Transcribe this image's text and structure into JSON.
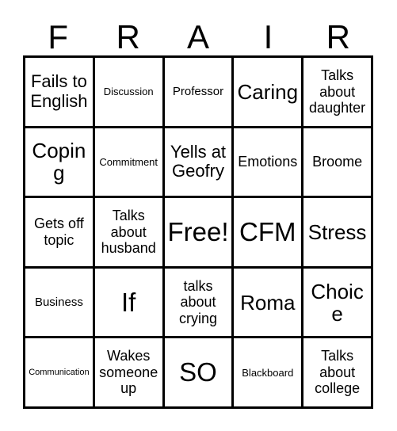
{
  "card": {
    "title_letters": [
      "F",
      "R",
      "A",
      "I",
      "R"
    ],
    "border_color": "#000000",
    "background_color": "#ffffff",
    "text_color": "#000000",
    "columns": 5,
    "rows": 5,
    "free_space": "Free!",
    "free_space_position": {
      "row": 3,
      "column": 3
    },
    "cells": [
      [
        {
          "label": "Fails to English",
          "size": "lg"
        },
        {
          "label": "Discussion",
          "size": "xs"
        },
        {
          "label": "Professor",
          "size": "sm"
        },
        {
          "label": "Caring",
          "size": "xl"
        },
        {
          "label": "Talks about daughter",
          "size": "md"
        }
      ],
      [
        {
          "label": "Coping",
          "size": "xl"
        },
        {
          "label": "Commitment",
          "size": "xs"
        },
        {
          "label": "Yells at Geofry",
          "size": "lg"
        },
        {
          "label": "Emotions",
          "size": "md"
        },
        {
          "label": "Broome",
          "size": "md"
        }
      ],
      [
        {
          "label": "Gets off topic",
          "size": "md"
        },
        {
          "label": "Talks about husband",
          "size": "md"
        },
        {
          "label": "Free!",
          "size": "xxl"
        },
        {
          "label": "CFM",
          "size": "xxl"
        },
        {
          "label": "Stress",
          "size": "xl"
        }
      ],
      [
        {
          "label": "Business",
          "size": "sm"
        },
        {
          "label": "If",
          "size": "xxl"
        },
        {
          "label": "talks about crying",
          "size": "md"
        },
        {
          "label": "Roma",
          "size": "xl"
        },
        {
          "label": "Choice",
          "size": "xl"
        }
      ],
      [
        {
          "label": "Communication",
          "size": "xxs"
        },
        {
          "label": "Wakes someone up",
          "size": "md"
        },
        {
          "label": "SO",
          "size": "xxl"
        },
        {
          "label": "Blackboard",
          "size": "xs"
        },
        {
          "label": "Talks about college",
          "size": "md"
        }
      ]
    ]
  }
}
